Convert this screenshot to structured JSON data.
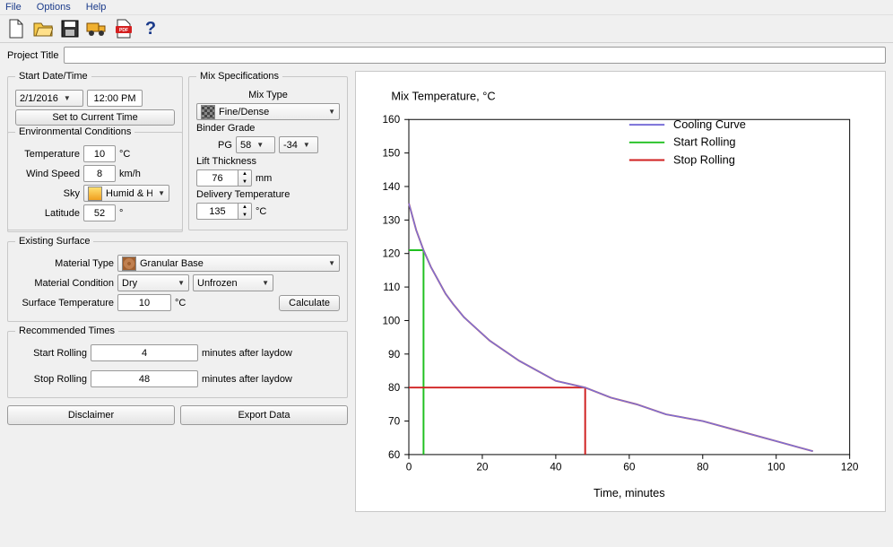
{
  "menu": {
    "file": "File",
    "options": "Options",
    "help": "Help"
  },
  "project": {
    "title_label": "Project Title",
    "title_value": ""
  },
  "start": {
    "legend": "Start Date/Time",
    "date": "2/1/2016",
    "time": "12:00 PM",
    "set_current": "Set to Current Time"
  },
  "mix": {
    "legend": "Mix Specifications",
    "type_label": "Mix Type",
    "type_value": "Fine/Dense",
    "binder_label": "Binder Grade",
    "binder_prefix": "PG",
    "binder_high": "58",
    "binder_low": "-34",
    "lift_label": "Lift Thickness",
    "lift_value": "76",
    "lift_unit": "mm",
    "delivery_label": "Delivery Temperature",
    "delivery_value": "135",
    "delivery_unit": "°C"
  },
  "env": {
    "legend": "Environmental Conditions",
    "temp_label": "Temperature",
    "temp_value": "10",
    "temp_unit": "°C",
    "wind_label": "Wind Speed",
    "wind_value": "8",
    "wind_unit": "km/h",
    "sky_label": "Sky",
    "sky_value": "Humid & Hazy",
    "lat_label": "Latitude",
    "lat_value": "52",
    "lat_unit": "°"
  },
  "surface": {
    "legend": "Existing Surface",
    "material_type_label": "Material Type",
    "material_type_value": "Granular Base",
    "material_cond_label": "Material Condition",
    "cond_wet": "Dry",
    "cond_frozen": "Unfrozen",
    "surf_temp_label": "Surface Temperature",
    "surf_temp_value": "10",
    "surf_temp_unit": "°C",
    "calc": "Calculate"
  },
  "rec": {
    "legend": "Recommended Times",
    "start_label": "Start Rolling",
    "start_value": "4",
    "stop_label": "Stop Rolling",
    "stop_value": "48",
    "suffix": "minutes after laydow"
  },
  "buttons": {
    "disclaimer": "Disclaimer",
    "export": "Export Data"
  },
  "chart": {
    "title": "Mix Temperature, °C",
    "xlabel": "Time, minutes",
    "legend": {
      "cooling": "Cooling Curve",
      "start": "Start Rolling",
      "stop": "Stop Rolling"
    }
  },
  "chart_data": {
    "type": "line",
    "title": "Mix Temperature, °C",
    "xlabel": "Time, minutes",
    "ylabel": "Mix Temperature, °C",
    "xlim": [
      0,
      120
    ],
    "ylim": [
      60,
      160
    ],
    "xticks": [
      0,
      20,
      40,
      60,
      80,
      100,
      120
    ],
    "yticks": [
      60,
      70,
      80,
      90,
      100,
      110,
      120,
      130,
      140,
      150,
      160
    ],
    "series": [
      {
        "name": "Cooling Curve",
        "color": "#7a6fd8",
        "x": [
          0,
          2,
          4,
          6,
          8,
          10,
          12,
          15,
          18,
          22,
          26,
          30,
          35,
          40,
          48,
          55,
          62,
          70,
          80,
          90,
          100,
          110
        ],
        "values": [
          135,
          127,
          121,
          116,
          112,
          108,
          105,
          101,
          98,
          94,
          91,
          88,
          85,
          82,
          80,
          77,
          75,
          72,
          70,
          67,
          64,
          61
        ]
      }
    ],
    "markers": {
      "start_rolling": {
        "time": 4,
        "temp": 121,
        "color": "#20c020"
      },
      "stop_rolling": {
        "time": 48,
        "temp": 80,
        "color": "#d02020"
      }
    }
  }
}
